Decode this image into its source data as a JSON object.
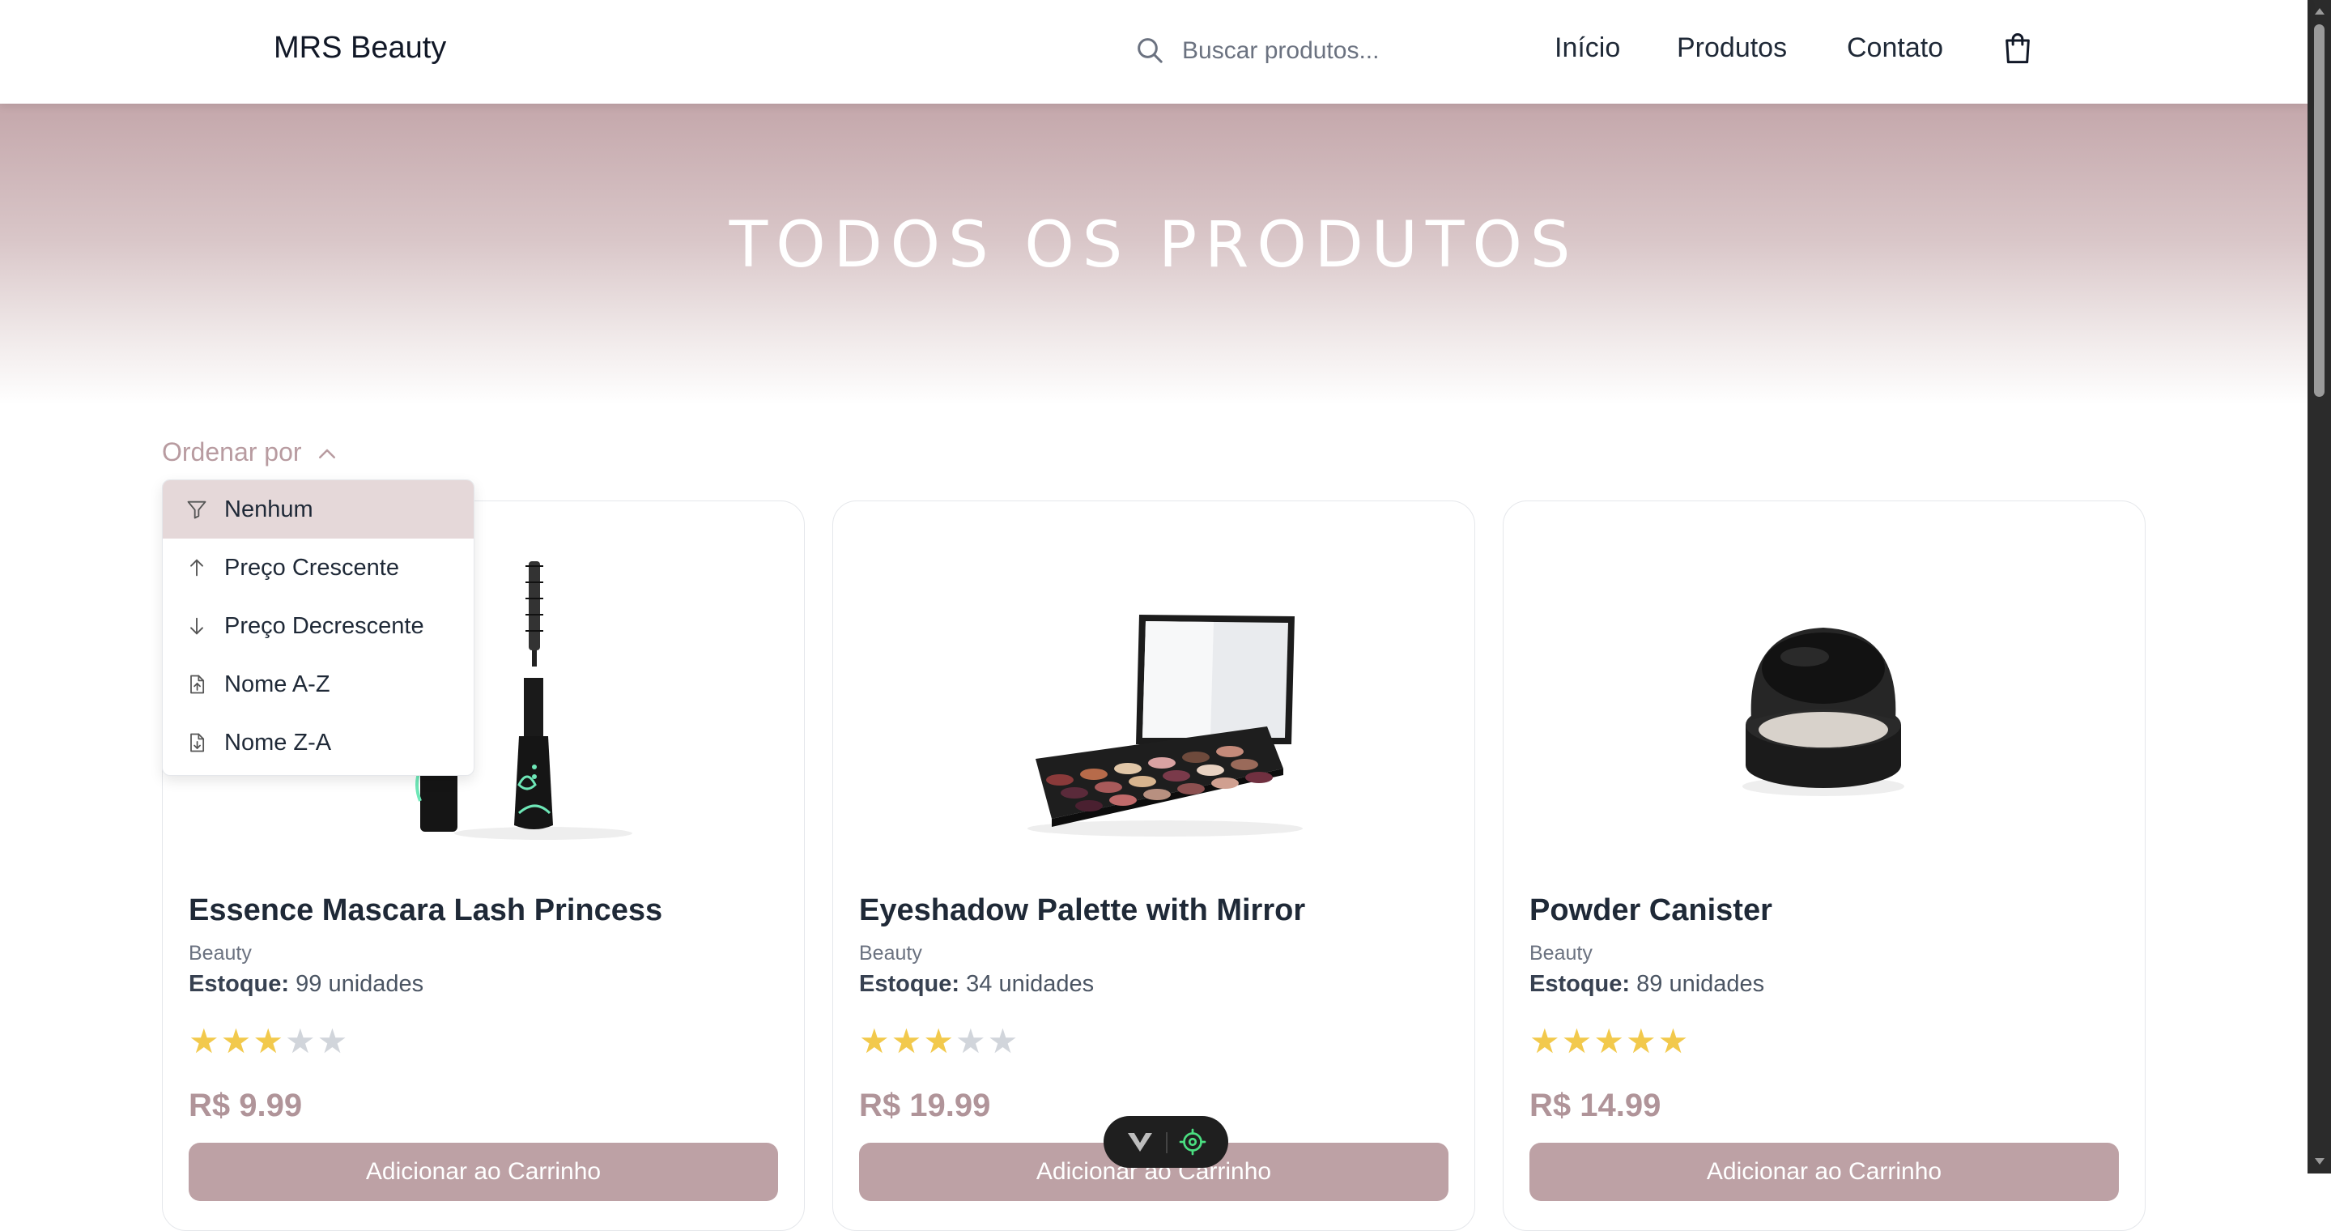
{
  "header": {
    "brand": "MRS Beauty",
    "search_placeholder": "Buscar produtos...",
    "nav": [
      "Início",
      "Produtos",
      "Contato"
    ],
    "icons": [
      "search-icon",
      "shopping-bag-icon"
    ]
  },
  "hero": {
    "title": "TODOS OS PRODUTOS"
  },
  "sort": {
    "label": "Ordenar por",
    "options": [
      {
        "label": "Nenhum",
        "icon": "filter-icon",
        "selected": true
      },
      {
        "label": "Preço Crescente",
        "icon": "arrow-up-icon"
      },
      {
        "label": "Preço Decrescente",
        "icon": "arrow-down-icon"
      },
      {
        "label": "Nome A-Z",
        "icon": "file-up-icon"
      },
      {
        "label": "Nome Z-A",
        "icon": "file-down-icon"
      }
    ]
  },
  "products": [
    {
      "name": "Essence Mascara Lash Princess",
      "category": "Beauty",
      "stock_label": "Estoque:",
      "stock": "99 unidades",
      "rating": 3,
      "price": "R$ 9.99",
      "button": "Adicionar ao Carrinho"
    },
    {
      "name": "Eyeshadow Palette with Mirror",
      "category": "Beauty",
      "stock_label": "Estoque:",
      "stock": "34 unidades",
      "rating": 3,
      "price": "R$ 19.99",
      "button": "Adicionar ao Carrinho"
    },
    {
      "name": "Powder Canister",
      "category": "Beauty",
      "stock_label": "Estoque:",
      "stock": "89 unidades",
      "rating": 5,
      "price": "R$ 14.99",
      "button": "Adicionar ao Carrinho"
    }
  ],
  "colors": {
    "accent": "#bda1a5",
    "price": "#b09499",
    "star": "#f2c94c",
    "star_empty": "#d1d5db"
  }
}
